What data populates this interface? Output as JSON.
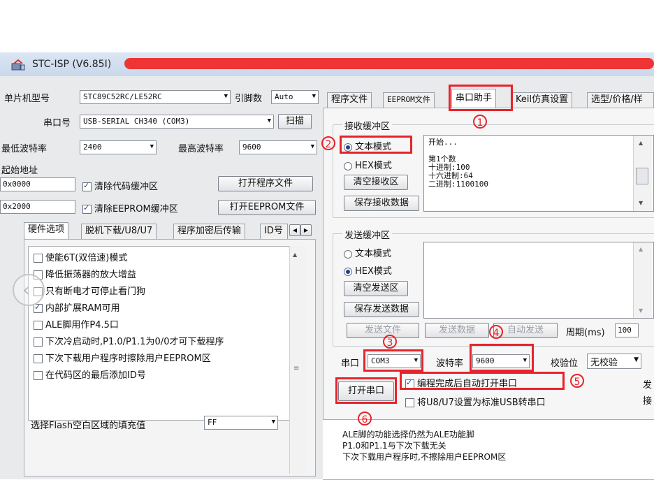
{
  "window": {
    "title": "STC-ISP (V6.85I)"
  },
  "left": {
    "mcu_label": "单片机型号",
    "mcu_value": "STC89C52RC/LE52RC",
    "pins_label": "引脚数",
    "pins_value": "Auto",
    "port_label": "串口号",
    "port_value": "USB-SERIAL CH340 (COM3)",
    "scan_label": "扫描",
    "min_baud_label": "最低波特率",
    "min_baud_value": "2400",
    "max_baud_label": "最高波特率",
    "max_baud_value": "9600",
    "start_addr_label": "起始地址",
    "addr1": "0x0000",
    "clear_code_label": "清除代码缓冲区",
    "open_prog_label": "打开程序文件",
    "addr2": "0x2000",
    "clear_eeprom_label": "清除EEPROM缓冲区",
    "open_eeprom_label": "打开EEPROM文件",
    "tabs": [
      "硬件选项",
      "脱机下载/U8/U7",
      "程序加密后传输",
      "ID号"
    ],
    "options": [
      {
        "label": "使能6T(双倍速)模式",
        "checked": false
      },
      {
        "label": "降低振荡器的放大增益",
        "checked": false
      },
      {
        "label": "只有断电才可停止看门狗",
        "checked": false
      },
      {
        "label": "内部扩展RAM可用",
        "checked": true
      },
      {
        "label": "ALE脚用作P4.5口",
        "checked": false
      },
      {
        "label": "下次冷启动时,P1.0/P1.1为0/0才可下载程序",
        "checked": false
      },
      {
        "label": "下次下载用户程序时擦除用户EEPROM区",
        "checked": false
      },
      {
        "label": "在代码区的最后添加ID号",
        "checked": false
      }
    ],
    "fill_label": "选择Flash空白区域的填充值",
    "fill_value": "FF"
  },
  "right": {
    "tabs": [
      "程序文件",
      "EEPROM文件",
      "串口助手",
      "Keil仿真设置",
      "选型/价格/样"
    ],
    "recv_group": "接收缓冲区",
    "text_mode": "文本模式",
    "hex_mode": "HEX模式",
    "clear_recv": "清空接收区",
    "save_recv": "保存接收数据",
    "recv_lines": [
      "开始...",
      "",
      "第1个数",
      "十进制:100",
      "十六进制:64",
      "二进制:1100100"
    ],
    "send_group": "发送缓冲区",
    "clear_send": "清空发送区",
    "save_send": "保存发送数据",
    "send_file": "发送文件",
    "send_data": "发送数据",
    "auto_send": "自动发送",
    "period_label": "周期(ms)",
    "period_value": "100",
    "port_label": "串口",
    "port_value": "COM3",
    "baud_label": "波特率",
    "baud_value": "9600",
    "parity_label": "校验位",
    "parity_value": "无校验",
    "open_port": "打开串口",
    "auto_open_label": "编程完成后自动打开串口",
    "u8_label": "将U8/U7设置为标准USB转串口",
    "side_text1": "发",
    "side_text2": "接",
    "notes": [
      "ALE脚的功能选择仍然为ALE功能脚",
      "P1.0和P1.1与下次下载无关",
      "下次下载用户程序时,不擦除用户EEPROM区"
    ]
  },
  "annotations": [
    "1",
    "2",
    "3",
    "4",
    "5",
    "6"
  ],
  "colors": {
    "annotation_red": "#e8232a",
    "accent_blue": "#1d3e94"
  }
}
